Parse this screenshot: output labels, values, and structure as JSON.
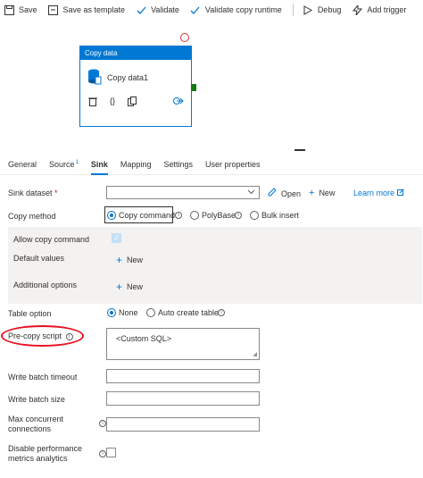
{
  "toolbar": {
    "save": "Save",
    "save_as_template": "Save as template",
    "validate": "Validate",
    "validate_copy_runtime": "Validate copy runtime",
    "debug": "Debug",
    "add_trigger": "Add trigger"
  },
  "activity": {
    "type": "Copy data",
    "name": "Copy data1"
  },
  "tabs": [
    {
      "label": "General"
    },
    {
      "label": "Source",
      "badge": "1"
    },
    {
      "label": "Sink"
    },
    {
      "label": "Mapping"
    },
    {
      "label": "Settings"
    },
    {
      "label": "User properties"
    }
  ],
  "sink": {
    "dataset_label": "Sink dataset",
    "required_mark": "*",
    "dataset_value": "",
    "open": "Open",
    "new": "New",
    "learn_more": "Learn more",
    "copy_method_label": "Copy method",
    "copy_methods": [
      "Copy command",
      "PolyBase",
      "Bulk insert"
    ],
    "allow_copy_command": "Allow copy command",
    "default_values": "Default values",
    "default_values_new": "New",
    "additional_options": "Additional options",
    "additional_options_new": "New",
    "table_option_label": "Table option",
    "table_options": [
      "None",
      "Auto create table"
    ],
    "pre_copy_script_label": "Pre-copy script",
    "pre_copy_script_value": "<Custom SQL>",
    "write_batch_timeout": "Write batch timeout",
    "write_batch_size": "Write batch size",
    "max_concurrent_line1": "Max concurrent",
    "max_concurrent_line2": "connections",
    "disable_perf_line1": "Disable performance",
    "disable_perf_line2": "metrics analytics"
  },
  "colors": {
    "accent": "#0078d4",
    "annotation": "#e81123",
    "success": "#107c10"
  }
}
